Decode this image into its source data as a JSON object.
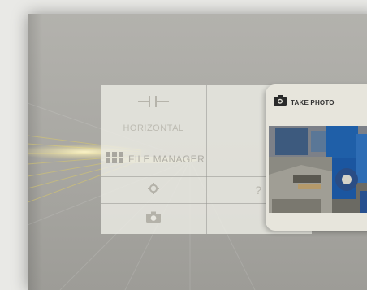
{
  "menu": {
    "horizontal_label": "HORIZONTAL",
    "value_label": "VALU",
    "file_manager_label": "FILE MANAGER",
    "settings_icon": "gear-icon",
    "help_icon": "question-icon",
    "camera_icon": "camera-icon",
    "horizontal_icon": "horizontal-connector-icon",
    "value_icon": "value-connector-icon"
  },
  "photo_card": {
    "title": "TAKE PHOTO",
    "icon": "camera-icon"
  },
  "colors": {
    "panel_bg": "#ecebe4",
    "accent_blue": "#2e6db5",
    "card_bg": "#e7e5dc"
  }
}
